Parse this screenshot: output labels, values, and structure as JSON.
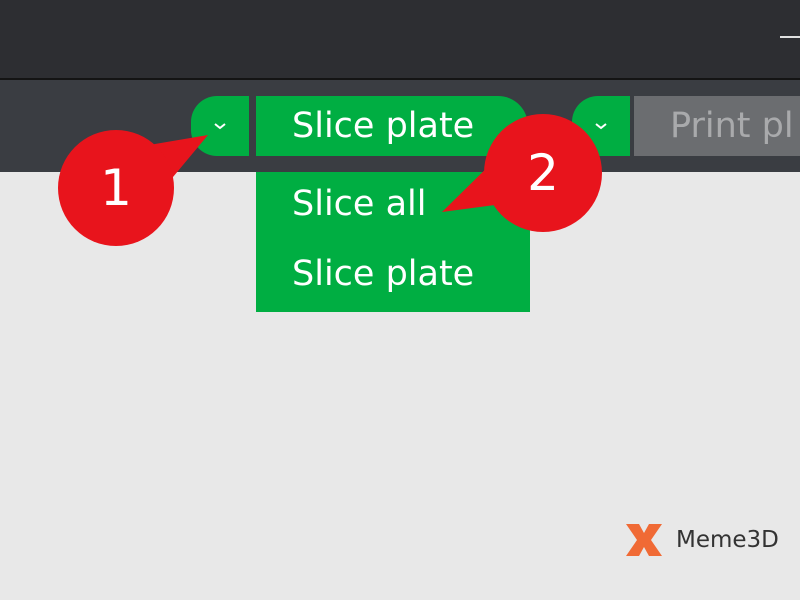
{
  "toolbar": {
    "slice_button_label": "Slice plate",
    "print_button_label": "Print pl",
    "slice_dropdown_icon": "chevron-down-icon",
    "print_dropdown_icon": "chevron-down-icon"
  },
  "slice_menu": {
    "items": [
      {
        "label": "Slice all"
      },
      {
        "label": "Slice plate"
      }
    ]
  },
  "callouts": [
    {
      "number": "1"
    },
    {
      "number": "2"
    }
  ],
  "brand": {
    "name": "Meme3D"
  },
  "colors": {
    "accent_green": "#00ae42",
    "callout_red": "#e8141c",
    "titlebar_dark": "#2d2e32",
    "toolbar_gray": "#3a3d42",
    "workspace_bg": "#e8e8e8",
    "disabled_button": "#6b6d70",
    "logo_orange": "#f06a35"
  }
}
